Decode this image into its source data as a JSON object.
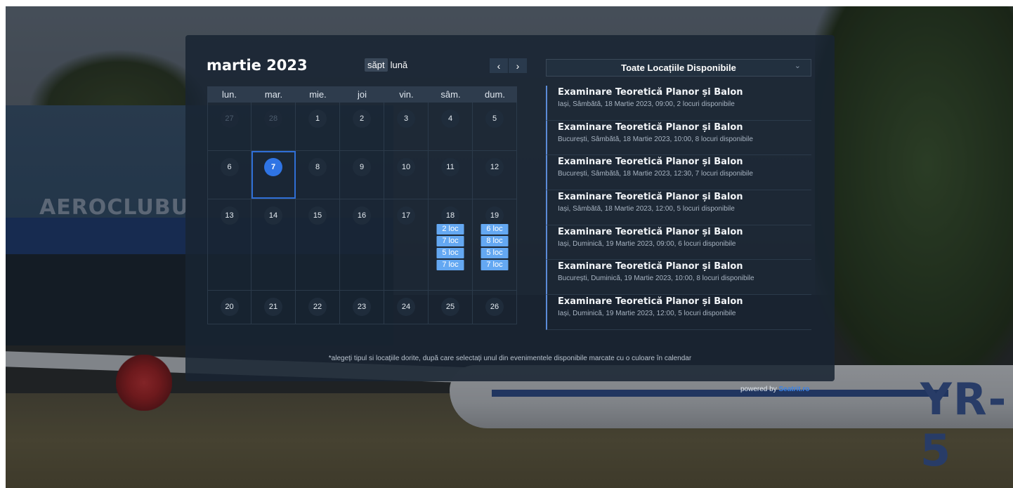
{
  "background": {
    "hangar_sign": "AEROCLUBU",
    "plane_registration": "YR-5"
  },
  "calendar": {
    "title": "martie 2023",
    "views": [
      "săpt",
      "lună"
    ],
    "active_view": "lună",
    "nav_prev": "‹",
    "nav_next": "›",
    "weekday_labels": [
      "lun.",
      "mar.",
      "mie.",
      "joi",
      "vin.",
      "sâm.",
      "dum."
    ],
    "weeks": [
      [
        "27",
        "28",
        "1",
        "2",
        "3",
        "4",
        "5"
      ],
      [
        "6",
        "7",
        "8",
        "9",
        "10",
        "11",
        "12"
      ],
      [
        "13",
        "14",
        "15",
        "16",
        "17",
        "18",
        "19"
      ],
      [
        "20",
        "21",
        "22",
        "23",
        "24",
        "25",
        "26"
      ]
    ],
    "today": "7",
    "slots_sat_18": [
      "2 loc",
      "7 loc",
      "5 loc",
      "7 loc"
    ],
    "slots_sun_19": [
      "6 loc",
      "8 loc",
      "5 loc",
      "7 loc"
    ]
  },
  "location_select": {
    "value": "Toate Locațiile Disponibile"
  },
  "events": [
    {
      "title": "Examinare Teoretică Planor și Balon",
      "details": "Iași, Sâmbătă, 18 Martie 2023, 09:00, 2 locuri disponibile"
    },
    {
      "title": "Examinare Teoretică Planor și Balon",
      "details": "București, Sâmbătă, 18 Martie 2023, 10:00, 8 locuri disponibile"
    },
    {
      "title": "Examinare Teoretică Planor și Balon",
      "details": "București, Sâmbătă, 18 Martie 2023, 12:30, 7 locuri disponibile"
    },
    {
      "title": "Examinare Teoretică Planor și Balon",
      "details": "Iași, Sâmbătă, 18 Martie 2023, 12:00, 5 locuri disponibile"
    },
    {
      "title": "Examinare Teoretică Planor și Balon",
      "details": "Iași, Duminică, 19 Martie 2023, 09:00, 6 locuri disponibile"
    },
    {
      "title": "Examinare Teoretică Planor și Balon",
      "details": "București, Duminică, 19 Martie 2023, 10:00, 8 locuri disponibile"
    },
    {
      "title": "Examinare Teoretică Planor și Balon",
      "details": "Iași, Duminică, 19 Martie 2023, 12:00, 5 locuri disponibile"
    }
  ],
  "footnote": "*alegeți tipul si locațiile dorite, după care selectați unul din evenimentele disponibile marcate cu o culoare în calendar",
  "powered": {
    "text": "powered by",
    "brand": "Seatrit.ro"
  },
  "colors": {
    "accent": "#2f74e4",
    "slot": "#64a8f2",
    "panel": "#182432"
  }
}
